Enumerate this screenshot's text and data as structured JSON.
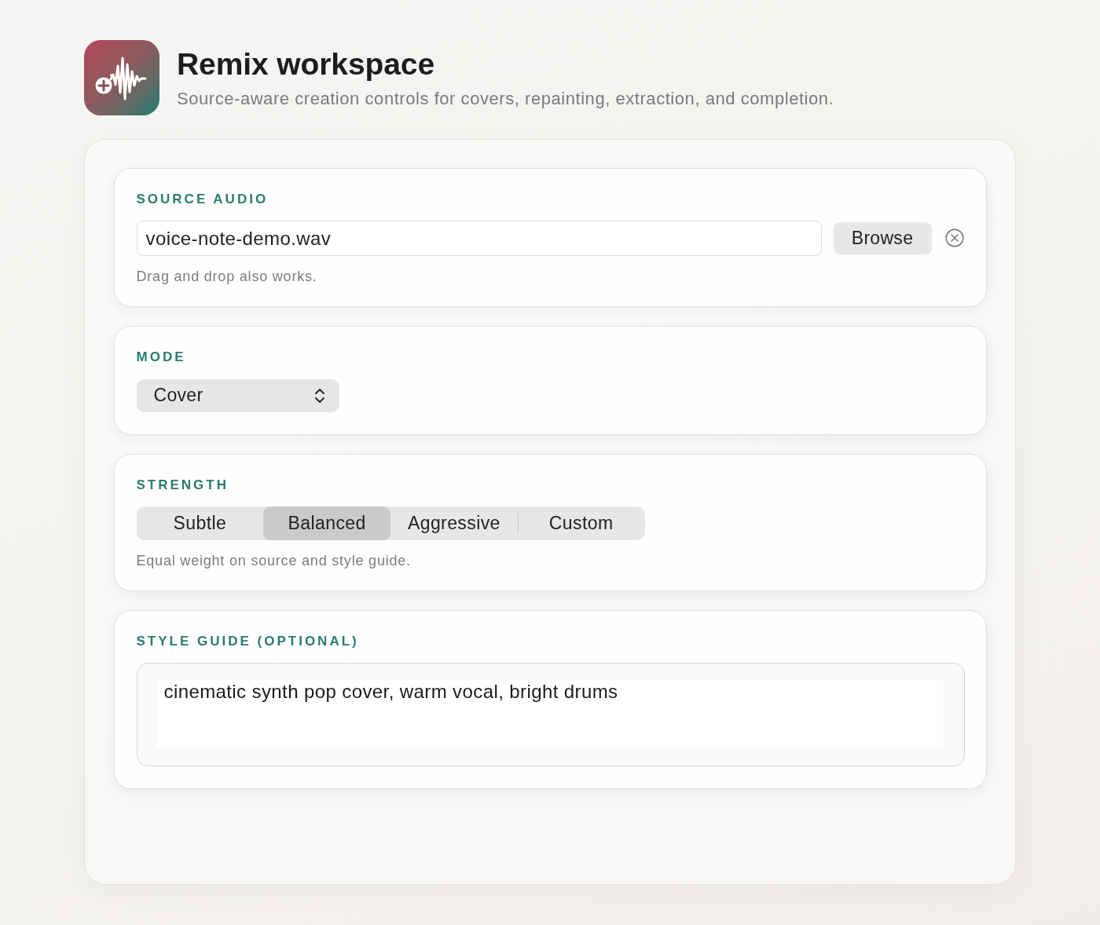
{
  "header": {
    "title": "Remix workspace",
    "subtitle": "Source-aware creation controls for covers, repainting, extraction, and completion."
  },
  "sections": [
    {
      "kind": "file",
      "label": "SOURCE AUDIO",
      "value": "voice-note-demo.wav",
      "button": "Browse",
      "hint": "Drag and drop also works."
    },
    {
      "kind": "select",
      "label": "MODE",
      "value": "Cover"
    },
    {
      "kind": "segmented",
      "label": "STRENGTH",
      "options": [
        {
          "label": "Subtle",
          "selected": false
        },
        {
          "label": "Balanced",
          "selected": true
        },
        {
          "label": "Aggressive",
          "selected": false
        },
        {
          "label": "Custom",
          "selected": false
        }
      ],
      "hint": "Equal weight on source and style guide."
    },
    {
      "kind": "textarea",
      "label": "STYLE GUIDE (OPTIONAL)",
      "value": "cinematic synth pop cover, warm vocal, bright drums"
    }
  ]
}
